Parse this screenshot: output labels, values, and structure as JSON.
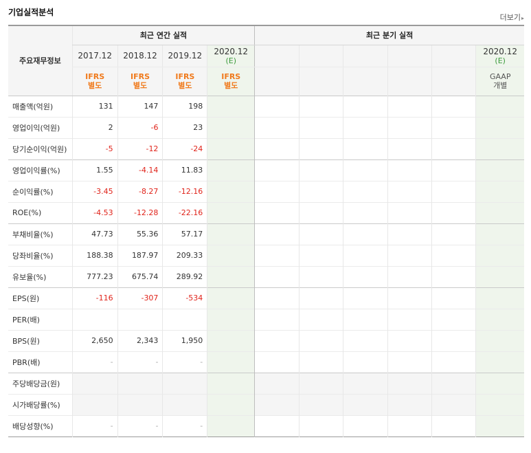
{
  "header": {
    "title": "기업실적분석",
    "more": "더보기",
    "more_arrow": "▸"
  },
  "col_header": {
    "label": "주요재무정보",
    "annual_title": "최근 연간 실적",
    "quarter_title": "최근 분기 실적",
    "annual_years": [
      "2017.12",
      "2018.12",
      "2019.12"
    ],
    "annual_est": {
      "year": "2020.12",
      "tag": "(E)"
    },
    "quarter_est": {
      "year": "2020.12",
      "tag": "(E)"
    },
    "annual_std": [
      {
        "l1": "IFRS",
        "l2": "별도"
      },
      {
        "l1": "IFRS",
        "l2": "별도"
      },
      {
        "l1": "IFRS",
        "l2": "별도"
      },
      {
        "l1": "IFRS",
        "l2": "별도"
      }
    ],
    "quarter_std": {
      "l1": "GAAP",
      "l2": "개별"
    }
  },
  "rows": [
    {
      "label": "매출액(억원)",
      "values": [
        "131",
        "147",
        "198"
      ],
      "neg": [
        false,
        false,
        false
      ]
    },
    {
      "label": "영업이익(억원)",
      "values": [
        "2",
        "-6",
        "23"
      ],
      "neg": [
        false,
        true,
        false
      ]
    },
    {
      "label": "당기순이익(억원)",
      "values": [
        "-5",
        "-12",
        "-24"
      ],
      "neg": [
        true,
        true,
        true
      ]
    },
    {
      "label": "영업이익률(%)",
      "values": [
        "1.55",
        "-4.14",
        "11.83"
      ],
      "neg": [
        false,
        true,
        false
      ]
    },
    {
      "label": "순이익률(%)",
      "values": [
        "-3.45",
        "-8.27",
        "-12.16"
      ],
      "neg": [
        true,
        true,
        true
      ]
    },
    {
      "label": "ROE(%)",
      "values": [
        "-4.53",
        "-12.28",
        "-22.16"
      ],
      "neg": [
        true,
        true,
        true
      ]
    },
    {
      "label": "부채비율(%)",
      "values": [
        "47.73",
        "55.36",
        "57.17"
      ],
      "neg": [
        false,
        false,
        false
      ]
    },
    {
      "label": "당좌비율(%)",
      "values": [
        "188.38",
        "187.97",
        "209.33"
      ],
      "neg": [
        false,
        false,
        false
      ]
    },
    {
      "label": "유보율(%)",
      "values": [
        "777.23",
        "675.74",
        "289.92"
      ],
      "neg": [
        false,
        false,
        false
      ]
    },
    {
      "label": "EPS(원)",
      "values": [
        "-116",
        "-307",
        "-534"
      ],
      "neg": [
        true,
        true,
        true
      ]
    },
    {
      "label": "PER(배)",
      "values": [
        "",
        "",
        ""
      ],
      "neg": [
        false,
        false,
        false
      ]
    },
    {
      "label": "BPS(원)",
      "values": [
        "2,650",
        "2,343",
        "1,950"
      ],
      "neg": [
        false,
        false,
        false
      ]
    },
    {
      "label": "PBR(배)",
      "values": [
        "-",
        "-",
        "-"
      ],
      "neg": [
        false,
        false,
        false
      ]
    },
    {
      "label": "주당배당금(원)",
      "values": [
        "",
        "",
        ""
      ],
      "neg": [
        false,
        false,
        false
      ]
    },
    {
      "label": "시가배당률(%)",
      "values": [
        "",
        "",
        ""
      ],
      "neg": [
        false,
        false,
        false
      ]
    },
    {
      "label": "배당성향(%)",
      "values": [
        "-",
        "-",
        "-"
      ],
      "neg": [
        false,
        false,
        false
      ]
    }
  ],
  "colors": {
    "negative": "#e0231a",
    "ifrs": "#f07a1c",
    "estimate": "#3a9a3a",
    "estimate_bg": "#eff5ec",
    "shade_bg": "#f5f5f5"
  }
}
